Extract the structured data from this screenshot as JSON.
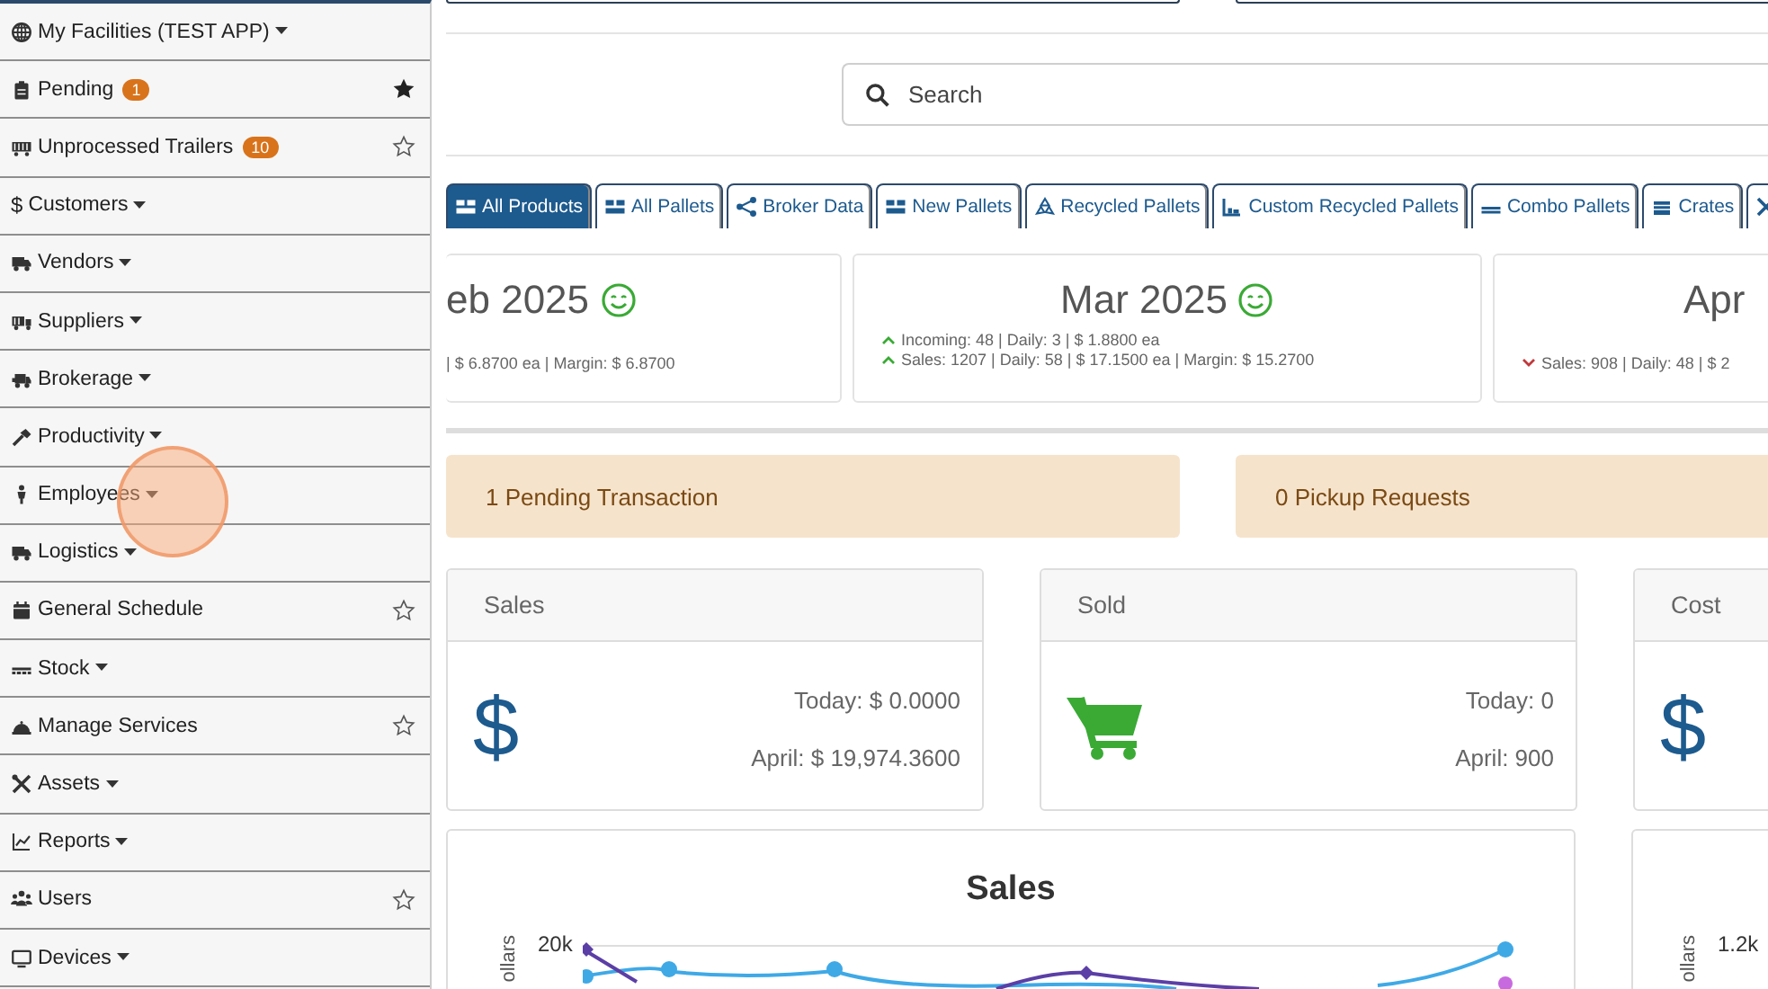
{
  "sidebar": {
    "items": [
      {
        "label": "My Facilities (TEST APP)",
        "kind": "dropdown"
      },
      {
        "label": "Pending",
        "kind": "link",
        "badge": "1",
        "favorite": true
      },
      {
        "label": "Unprocessed Trailers",
        "kind": "link",
        "badge": "10",
        "favorite": false
      },
      {
        "label": "Customers",
        "kind": "dropdown",
        "glyph": "$"
      },
      {
        "label": "Vendors",
        "kind": "dropdown"
      },
      {
        "label": "Suppliers",
        "kind": "dropdown"
      },
      {
        "label": "Brokerage",
        "kind": "dropdown"
      },
      {
        "label": "Productivity",
        "kind": "dropdown"
      },
      {
        "label": "Employees",
        "kind": "dropdown"
      },
      {
        "label": "Logistics",
        "kind": "dropdown"
      },
      {
        "label": "General Schedule",
        "kind": "link",
        "favorite": false
      },
      {
        "label": "Stock",
        "kind": "dropdown"
      },
      {
        "label": "Manage Services",
        "kind": "link",
        "favorite": false
      },
      {
        "label": "Assets",
        "kind": "dropdown"
      },
      {
        "label": "Reports",
        "kind": "dropdown"
      },
      {
        "label": "Users",
        "kind": "link",
        "favorite": false
      },
      {
        "label": "Devices",
        "kind": "dropdown"
      }
    ]
  },
  "cursor_highlight": true,
  "search": {
    "placeholder": "Search"
  },
  "tabs": [
    {
      "label": "All Products",
      "selected": true
    },
    {
      "label": "All Pallets",
      "selected": false
    },
    {
      "label": "Broker Data",
      "selected": false
    },
    {
      "label": "New Pallets",
      "selected": false
    },
    {
      "label": "Recycled Pallets",
      "selected": false
    },
    {
      "label": "Custom Recycled Pallets",
      "selected": false
    },
    {
      "label": "Combo Pallets",
      "selected": false
    },
    {
      "label": "Crates",
      "selected": false
    },
    {
      "selected": false
    }
  ],
  "months": [
    {
      "title": "eb 2025",
      "smiley": true,
      "lines": [
        {
          "text": "| $ 6.8700 ea | Margin: $ 6.8700"
        }
      ]
    },
    {
      "title": "Mar 2025",
      "smiley": true,
      "lines": [
        {
          "rising": true,
          "text": "Incoming: 48 | Daily: 3 | $ 1.8800 ea"
        },
        {
          "rising": true,
          "text": "Sales: 1207 | Daily: 58 | $ 17.1500 ea | Margin: $ 15.2700"
        }
      ]
    },
    {
      "title": "Apr",
      "smiley": false,
      "lines": [
        {
          "rising": false,
          "text": "Sales: 908 | Daily: 48 | $ 2"
        }
      ]
    }
  ],
  "alerts": [
    "1 Pending Transaction",
    "0 Pickup Requests"
  ],
  "stats": [
    {
      "title": "Sales",
      "glyph": "$",
      "today": "Today: $ 0.0000",
      "month": "April: $ 19,974.3600"
    },
    {
      "title": "Sold",
      "kind": "cart",
      "today": "Today: 0",
      "month": "April: 900"
    },
    {
      "title": "Cost",
      "glyph": "$"
    }
  ],
  "charts": [
    {
      "title": "Sales",
      "ylabel": "ollars",
      "tick": "20k"
    },
    {
      "ylabel": "ollars",
      "tick": "1.2k"
    }
  ]
}
